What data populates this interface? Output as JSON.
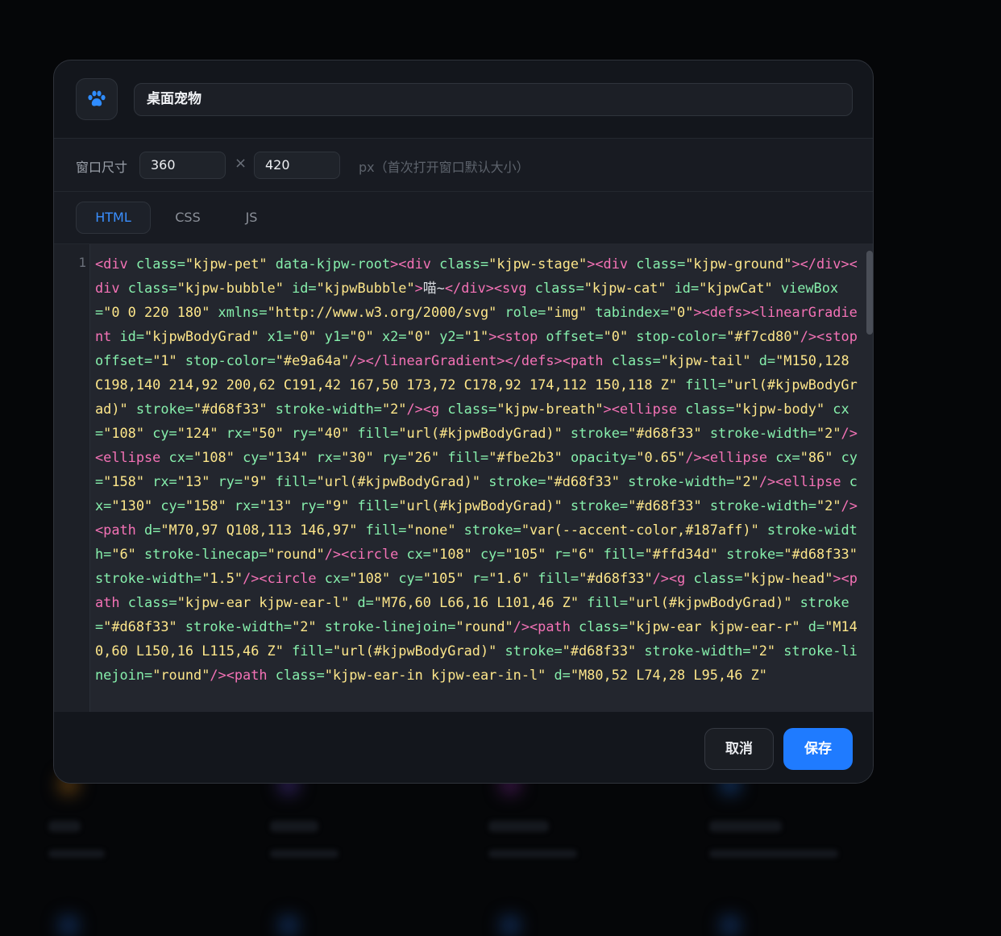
{
  "dialog": {
    "app_icon": "paw-icon",
    "name_value": "桌面宠物",
    "size_label": "窗口尺寸",
    "width_value": "360",
    "times_symbol": "×",
    "height_value": "420",
    "size_hint": "px（首次打开窗口默认大小）",
    "tabs": [
      {
        "label": "HTML",
        "active": true
      },
      {
        "label": "CSS",
        "active": false
      },
      {
        "label": "JS",
        "active": false
      }
    ],
    "line_number": "1",
    "code_html": "<div class=\"kjpw-pet\" data-kjpw-root><div class=\"kjpw-stage\"><div class=\"kjpw-ground\"></div><div class=\"kjpw-bubble\" id=\"kjpwBubble\">喵~</div><svg class=\"kjpw-cat\" id=\"kjpwCat\" viewBox=\"0 0 220 180\" xmlns=\"http://www.w3.org/2000/svg\" role=\"img\" tabindex=\"0\"><defs><linearGradient id=\"kjpwBodyGrad\" x1=\"0\" y1=\"0\" x2=\"0\" y2=\"1\"><stop offset=\"0\" stop-color=\"#f7cd80\"/><stop offset=\"1\" stop-color=\"#e9a64a\"/></linearGradient></defs><path class=\"kjpw-tail\" d=\"M150,128 C198,140 214,92 200,62 C191,42 167,50 173,72 C178,92 174,112 150,118 Z\" fill=\"url(#kjpwBodyGrad)\" stroke=\"#d68f33\" stroke-width=\"2\"/><g class=\"kjpw-breath\"><ellipse class=\"kjpw-body\" cx=\"108\" cy=\"124\" rx=\"50\" ry=\"40\" fill=\"url(#kjpwBodyGrad)\" stroke=\"#d68f33\" stroke-width=\"2\"/><ellipse cx=\"108\" cy=\"134\" rx=\"30\" ry=\"26\" fill=\"#fbe2b3\" opacity=\"0.65\"/><ellipse cx=\"86\" cy=\"158\" rx=\"13\" ry=\"9\" fill=\"url(#kjpwBodyGrad)\" stroke=\"#d68f33\" stroke-width=\"2\"/><ellipse cx=\"130\" cy=\"158\" rx=\"13\" ry=\"9\" fill=\"url(#kjpwBodyGrad)\" stroke=\"#d68f33\" stroke-width=\"2\"/><path d=\"M70,97 Q108,113 146,97\" fill=\"none\" stroke=\"var(--accent-color,#187aff)\" stroke-width=\"6\" stroke-linecap=\"round\"/><circle cx=\"108\" cy=\"105\" r=\"6\" fill=\"#ffd34d\" stroke=\"#d68f33\" stroke-width=\"1.5\"/><circle cx=\"108\" cy=\"105\" r=\"1.6\" fill=\"#d68f33\"/><g class=\"kjpw-head\"><path class=\"kjpw-ear kjpw-ear-l\" d=\"M76,60 L66,16 L101,46 Z\" fill=\"url(#kjpwBodyGrad)\" stroke=\"#d68f33\" stroke-width=\"2\" stroke-linejoin=\"round\"/><path class=\"kjpw-ear kjpw-ear-r\" d=\"M140,60 L150,16 L115,46 Z\" fill=\"url(#kjpwBodyGrad)\" stroke=\"#d68f33\" stroke-width=\"2\" stroke-linejoin=\"round\"/><path class=\"kjpw-ear-in kjpw-ear-in-l\" d=\"M80,52 L74,28 L95,46 Z\"",
    "cancel_label": "取消",
    "save_label": "保存"
  },
  "colors": {
    "accent": "#1f7bff",
    "tag": "#f472b6",
    "attribute": "#86efac",
    "string": "#fde68a"
  }
}
